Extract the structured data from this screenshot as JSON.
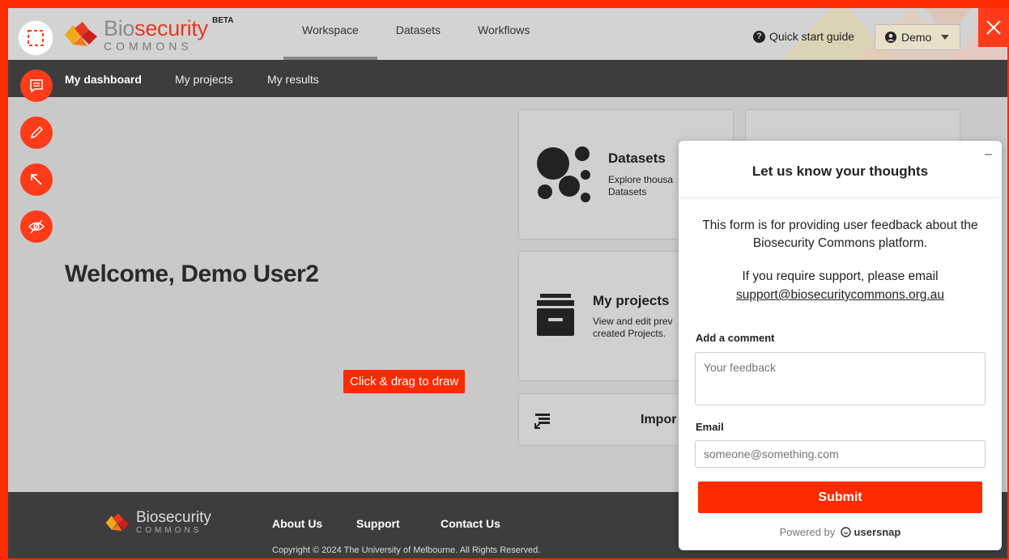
{
  "header": {
    "logo": {
      "bio": "Bio",
      "security": "security",
      "commons": "COMMONS",
      "beta": "BETA"
    },
    "tabs": [
      {
        "label": "Workspace",
        "active": true
      },
      {
        "label": "Datasets"
      },
      {
        "label": "Workflows"
      }
    ],
    "quick_start": "Quick start guide",
    "user_menu": "Demo"
  },
  "subnav": {
    "items": [
      {
        "label": "My dashboard",
        "active": true
      },
      {
        "label": "My projects"
      },
      {
        "label": "My results"
      }
    ]
  },
  "main": {
    "welcome": "Welcome, Demo User2",
    "cards": {
      "datasets": {
        "title": "Datasets",
        "desc1": "Explore thousa",
        "desc2": "Datasets"
      },
      "projects": {
        "title": "My projects",
        "desc1": "View and edit prev",
        "desc2": "created Projects."
      },
      "import": {
        "title": "Impor"
      }
    }
  },
  "annotation": {
    "draw_hint": "Click & drag to draw"
  },
  "feedback": {
    "title": "Let us know your thoughts",
    "minimize": "–",
    "intro": "This form is for providing user feedback about the Biosecurity Commons platform.",
    "support_text": "If you require support, please email",
    "support_email": "support@biosecuritycommons.org.au",
    "comment_label": "Add a comment",
    "comment_placeholder": "Your feedback",
    "email_label": "Email",
    "email_placeholder": "someone@something.com",
    "submit": "Submit",
    "powered_by": "Powered by",
    "brand": "usersnap"
  },
  "footer": {
    "logo": {
      "bio": "Bio",
      "security": "security",
      "commons": "COMMONS"
    },
    "links": [
      "About Us",
      "Support",
      "Contact Us"
    ],
    "copyright": "Copyright © 2024 The University of Melbourne. All Rights Reserved."
  },
  "colors": {
    "accent": "#ff2a00",
    "brand_red": "#e43b20",
    "dark_bar": "#3d3d3d"
  }
}
